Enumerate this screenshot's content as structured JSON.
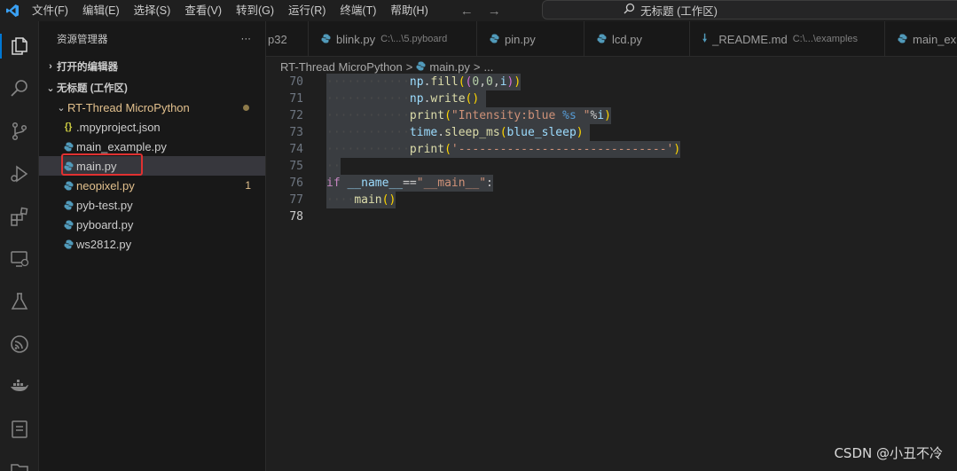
{
  "menu": [
    "文件(F)",
    "编辑(E)",
    "选择(S)",
    "查看(V)",
    "转到(G)",
    "运行(R)",
    "终端(T)",
    "帮助(H)"
  ],
  "command_center": {
    "text": "无标题 (工作区)"
  },
  "sidebar": {
    "title": "资源管理器",
    "more": "···",
    "open_editors": "打开的编辑器",
    "workspace": "无标题 (工作区)",
    "folder": "RT-Thread MicroPython",
    "files": [
      {
        "name": ".mpyproject.json",
        "icon": "json-icon"
      },
      {
        "name": "main_example.py",
        "icon": "python-icon"
      },
      {
        "name": "main.py",
        "icon": "python-icon"
      },
      {
        "name": "neopixel.py",
        "icon": "python-icon",
        "badge": "1"
      },
      {
        "name": "pyb-test.py",
        "icon": "python-icon"
      },
      {
        "name": "pyboard.py",
        "icon": "python-icon"
      },
      {
        "name": "ws2812.py",
        "icon": "python-icon"
      }
    ]
  },
  "tabs": [
    {
      "label": "p32",
      "sub": ""
    },
    {
      "label": "blink.py",
      "sub": "C:\\...\\5.pyboard"
    },
    {
      "label": "pin.py",
      "sub": ""
    },
    {
      "label": "lcd.py",
      "sub": ""
    },
    {
      "label": "_README.md",
      "sub": "C:\\...\\examples"
    },
    {
      "label": "main_ex",
      "sub": ""
    }
  ],
  "breadcrumb": {
    "folder": "RT-Thread MicroPython",
    "sep": ">",
    "file": "main.py",
    "more": "..."
  },
  "editor": {
    "line_numbers": [
      "70",
      "71",
      "72",
      "73",
      "74",
      "75",
      "76",
      "77",
      "78"
    ],
    "current_line": "78"
  },
  "watermark": "CSDN @小丑不冷",
  "colors": {
    "accent": "#0078d4",
    "highlight_box": "#e03131",
    "modified": "#e2c08d"
  }
}
